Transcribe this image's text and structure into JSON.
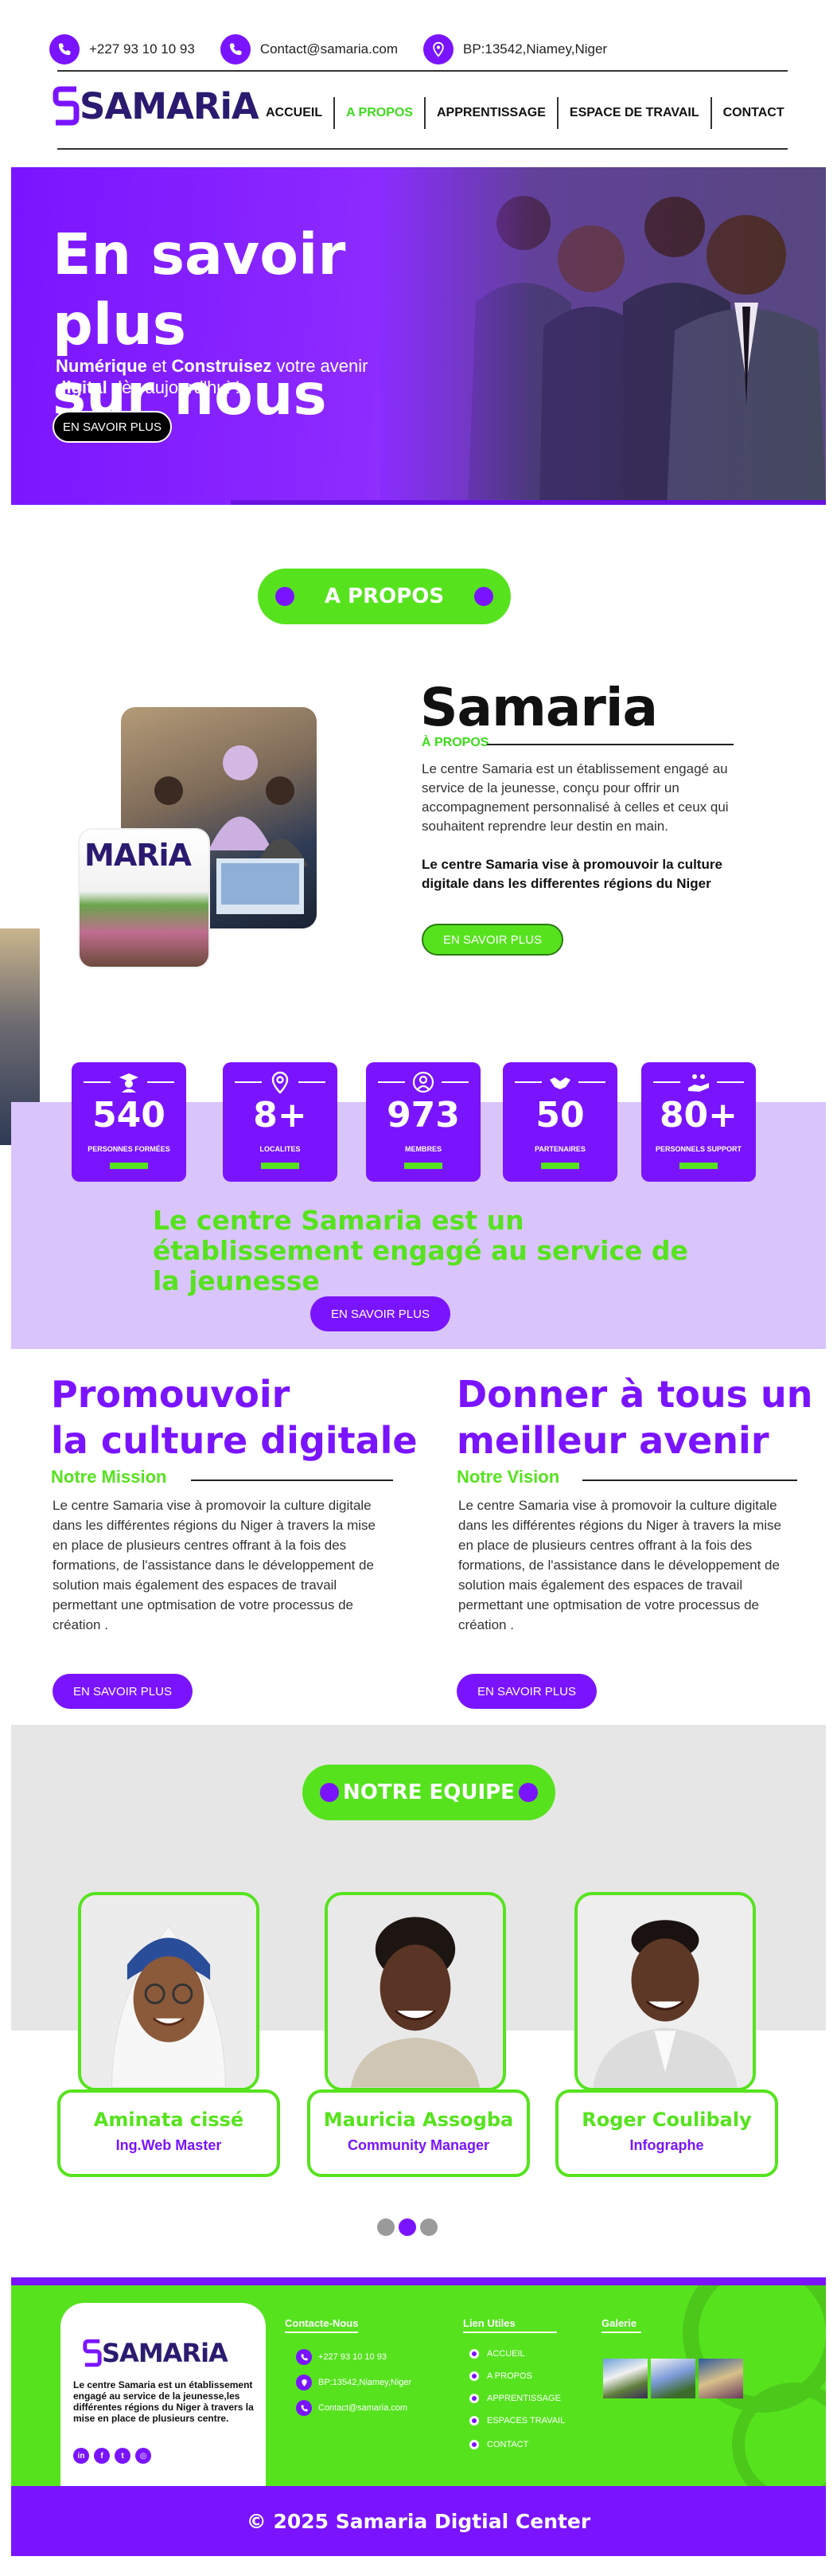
{
  "topbar": {
    "phone": "+227 93 10 10 93",
    "email": "Contact@samaria.com",
    "address": "BP:13542,Niamey,Niger",
    "icons": [
      "phone-icon",
      "phone-icon",
      "location-pin-icon"
    ]
  },
  "brand": {
    "name": "SAMARiA",
    "accent": "#7a14ff",
    "green": "#56e31e",
    "dark": "#2b1b70"
  },
  "nav": {
    "items": [
      {
        "label": "ACCUEIL",
        "active": false
      },
      {
        "label": "A PROPOS",
        "active": true
      },
      {
        "label": "APPRENTISSAGE",
        "active": false
      },
      {
        "label": "ESPACE DE TRAVAIL",
        "active": false
      },
      {
        "label": "CONTACT",
        "active": false
      }
    ]
  },
  "hero": {
    "title_line1": "En savoir plus",
    "title_line2": "sur nous",
    "subtitle_bold1": "Numérique",
    "subtitle_mid1": " et ",
    "subtitle_bold2": "Construisez",
    "subtitle_mid2": " votre avenir ",
    "subtitle_bold3": "digital",
    "subtitle_end": " dès aujourd'hui !",
    "button": "EN SAVOIR PLUS"
  },
  "about": {
    "pill": "A PROPOS",
    "title": "Samaria",
    "sub": "À PROPOS",
    "paragraph": "Le centre Samaria est un établissement engagé au service de la jeunesse, conçu pour offrir un accompagnement personnalisé à celles et ceux qui souhaitent reprendre leur destin en main.",
    "highlight": "Le centre Samaria vise à promouvoir  la culture digitale dans les differentes régions du Niger",
    "button": "EN SAVOIR PLUS",
    "photo_caption": "MARiA"
  },
  "stats": {
    "items": [
      {
        "value": "540",
        "label": "PERSONNES FORMÉES",
        "icon": "graduate-icon"
      },
      {
        "value": "8+",
        "label": "LOCALITES",
        "icon": "location-pin-icon"
      },
      {
        "value": "973",
        "label": "MEMBRES",
        "icon": "user-circle-icon"
      },
      {
        "value": "50",
        "label": "PARTENAIRES",
        "icon": "handshake-icon"
      },
      {
        "value": "80+",
        "label": "PERSONNELS SUPPORT",
        "icon": "helping-hand-icon"
      }
    ],
    "tagline": "Le centre Samaria est un établissement engagé au service de la jeunesse",
    "button": "EN SAVOIR PLUS"
  },
  "mission": {
    "title_line1": "Promouvoir",
    "title_line2": "la culture digitale",
    "sub": "Notre Mission",
    "text": "Le centre Samaria vise à promovoir la culture digitale dans les différentes régions du Niger à travers la mise en place de plusieurs centres offrant à la fois des formations, de l'assistance dans le développement de solution mais également des espaces de travail permettant une optmisation de votre processus de création .",
    "button": "EN SAVOIR PLUS"
  },
  "vision": {
    "title_line1": "Donner à tous un",
    "title_line2": "meilleur avenir",
    "sub": "Notre Vision",
    "text": "Le centre Samaria vise à promovoir la culture digitale dans les différentes régions du Niger à travers la mise en place de plusieurs centres offrant à la fois des formations, de l'assistance dans le développement de solution mais également des espaces de travail permettant une optmisation de votre processus de création .",
    "button": "EN SAVOIR PLUS"
  },
  "team": {
    "pill": "NOTRE EQUIPE",
    "members": [
      {
        "name": "Aminata cissé",
        "role": "Ing.Web Master"
      },
      {
        "name": "Mauricia Assogba",
        "role": "Community Manager"
      },
      {
        "name": "Roger Coulibaly",
        "role": "Infographe"
      }
    ],
    "pagination_active": 2
  },
  "footer": {
    "brand": "SAMARiA",
    "description": "Le centre Samaria est un établissement engagé au service de la jeunesse,les différentes régions du Niger à travers la mise en place de plusieurs centre.",
    "social": [
      "in",
      "f",
      "t",
      "◎"
    ],
    "contact_title": "Contacte-Nous",
    "contact": {
      "phone": "+227 93 10 10 93",
      "address": "BP:13542,Niamey,Niger",
      "email": "Contact@samaria.com"
    },
    "links_title": "Lien Utiles",
    "links": [
      "ACCUEIL",
      "A PROPOS",
      "APPRENTISSAGE",
      "ESPACES TRAVAIL",
      "CONTACT"
    ],
    "gallery_title": "Galerie",
    "copyright": "© 2025 Samaria Digtial Center"
  }
}
